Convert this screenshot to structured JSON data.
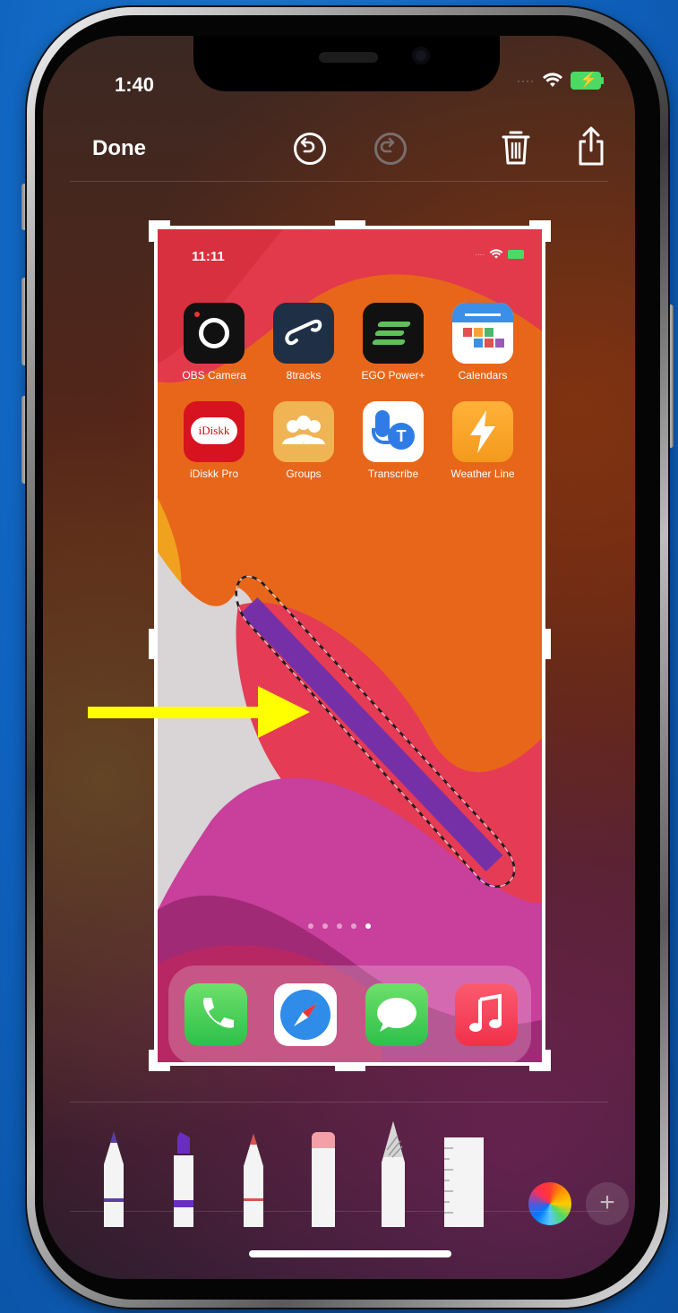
{
  "status_bar": {
    "time": "1:40"
  },
  "toolbar": {
    "done_label": "Done",
    "undo_icon": "undo-icon",
    "redo_icon": "redo-icon",
    "delete_icon": "trash-icon",
    "share_icon": "share-icon"
  },
  "screenshot": {
    "status_time": "11:11",
    "apps": [
      {
        "label": "OBS Camera",
        "icon": "obs-camera-icon"
      },
      {
        "label": "8tracks",
        "icon": "8tracks-icon"
      },
      {
        "label": "EGO Power+",
        "icon": "ego-power-icon"
      },
      {
        "label": "Calendars",
        "icon": "calendars-icon"
      },
      {
        "label": "iDiskk Pro",
        "icon": "idiskk-icon",
        "badge": "iDiskk"
      },
      {
        "label": "Groups",
        "icon": "groups-icon"
      },
      {
        "label": "Transcribe",
        "icon": "transcribe-icon",
        "badge": "T"
      },
      {
        "label": "Weather Line",
        "icon": "weather-line-icon"
      }
    ],
    "page_indicator": {
      "count": 5,
      "active": 5
    },
    "dock": [
      {
        "icon": "phone-icon"
      },
      {
        "icon": "safari-icon"
      },
      {
        "icon": "messages-icon"
      },
      {
        "icon": "music-icon"
      }
    ]
  },
  "tools": {
    "items": [
      "pen",
      "marker",
      "pencil",
      "eraser",
      "lasso",
      "ruler"
    ],
    "colors": {
      "pen": "#5b3ea6",
      "marker": "#6a2dc4",
      "pencil": "#d9534f"
    },
    "color_picker_icon": "color-wheel-icon",
    "more_label": "+"
  },
  "colors": {
    "accent_arrow": "#ffff00",
    "stroke": "#6b2fb0",
    "background": "#0f62bf"
  }
}
